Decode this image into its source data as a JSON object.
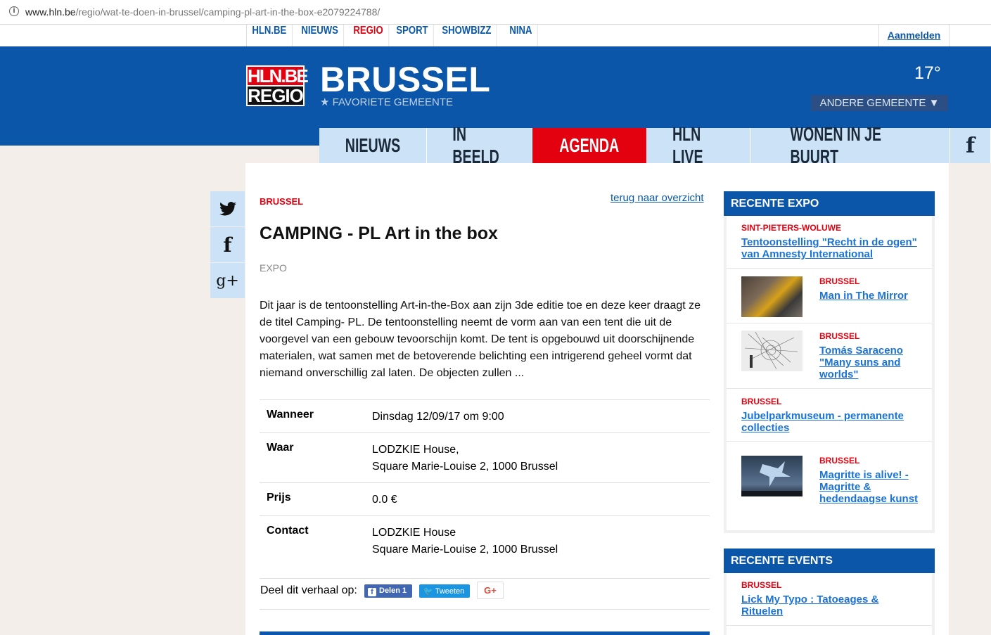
{
  "browser": {
    "url_domain": "www.hln.be",
    "url_path": "/regio/wat-te-doen-in-brussel/camping-pl-art-in-the-box-e2079224788/"
  },
  "topnav": {
    "links": [
      "HLN.BE",
      "NIEUWS",
      "REGIO",
      "SPORT",
      "SHOWBIZZ",
      "NINA"
    ],
    "login": "Aanmelden"
  },
  "header": {
    "logo_line1": "HLN.BE",
    "logo_line2": "REGIO",
    "city": "BRUSSEL",
    "favorite": "FAVORIETE GEMEENTE",
    "temperature": "17°",
    "other_city": "ANDERE GEMEENTE ▼"
  },
  "mainnav": [
    "NIEUWS",
    "IN BEELD",
    "AGENDA",
    "HLN LIVE",
    "WONEN IN JE BUURT"
  ],
  "article": {
    "location": "BRUSSEL",
    "back_link": "terug naar overzicht",
    "title": "CAMPING - PL Art in the box",
    "category": "EXPO",
    "body": "Dit jaar is de tentoonstelling Art-in-the-Box aan zijn 3de editie toe en deze keer draagt ze de titel Camping- PL. De tentoonstelling neemt de vorm aan van een tent die uit de voorgevel van een gebouw tevoorschijn komt. De tent is opgebouwd uit doorschijnende materialen, wat samen met de betoverende belichting een intrigerend geheel vormt dat niemand onverschillig zal laten. De objecten zullen ...",
    "details": [
      {
        "key": "Wanneer",
        "line1": "Dinsdag 12/09/17 om 9:00",
        "line2": ""
      },
      {
        "key": "Waar",
        "line1": "LODZKIE House,",
        "line2": "Square Marie-Louise 2, 1000 Brussel"
      },
      {
        "key": "Prijs",
        "line1": "0.0 €",
        "line2": ""
      },
      {
        "key": "Contact",
        "line1": "LODZKIE House",
        "line2": "Square Marie-Louise 2, 1000 Brussel"
      }
    ],
    "share_label": "Deel dit verhaal op:",
    "share_fb": "Delen 1",
    "share_tw": "Tweeten",
    "share_gp": "G+"
  },
  "expo": {
    "heading": "RECENTE EXPO",
    "items": [
      {
        "location": "SINT-PIETERS-WOLUWE",
        "title": "Tentoonstelling \"Recht in de ogen\" van Amnesty International"
      },
      {
        "location": "BRUSSEL",
        "title": "Man in The Mirror"
      },
      {
        "location": "BRUSSEL",
        "title": "Tomás Saraceno \"Many suns and worlds\""
      },
      {
        "location": "BRUSSEL",
        "title": "Jubelparkmuseum - permanente collecties"
      },
      {
        "location": "BRUSSEL",
        "title": "Magritte is alive! - Magritte & hedendaagse kunst"
      }
    ]
  },
  "events": {
    "heading": "RECENTE EVENTS",
    "items": [
      {
        "location": "BRUSSEL",
        "title": "Lick My Typo : Tatoeages & Rituelen"
      }
    ]
  },
  "colors": {
    "brand_blue": "#0b56a8",
    "brand_red": "#e3000f",
    "nav_light": "#cce3f7",
    "link_blue": "#1a73d9"
  }
}
